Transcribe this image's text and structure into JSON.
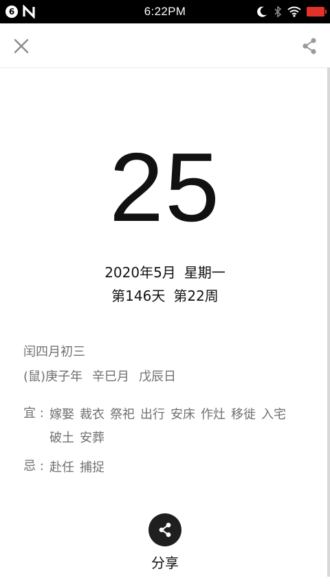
{
  "status_bar": {
    "notif_count": "6",
    "time": "6:22PM"
  },
  "toolbar": {
    "close_icon": "close-icon",
    "share_icon": "share-icon"
  },
  "date": {
    "day": "25",
    "year_month": "2020年5月",
    "weekday": "星期一",
    "day_of_year": "第146天",
    "week_of_year": "第22周"
  },
  "lunar": {
    "lunar_date": "闰四月初三",
    "year": "(鼠)庚子年",
    "month": "辛巳月",
    "day": "戊辰日"
  },
  "yi": {
    "label": "宜 :",
    "items": [
      "嫁娶",
      "裁衣",
      "祭祀",
      "出行",
      "安床",
      "作灶",
      "移徙",
      "入宅",
      "破土",
      "安葬"
    ]
  },
  "ji": {
    "label": "忌 :",
    "items": [
      "赴任",
      "捕捉"
    ]
  },
  "share": {
    "label": "分享"
  },
  "colors": {
    "battery": "#e3322b",
    "muted_text": "#6f6f6f",
    "share_button": "#1f1f1f"
  }
}
